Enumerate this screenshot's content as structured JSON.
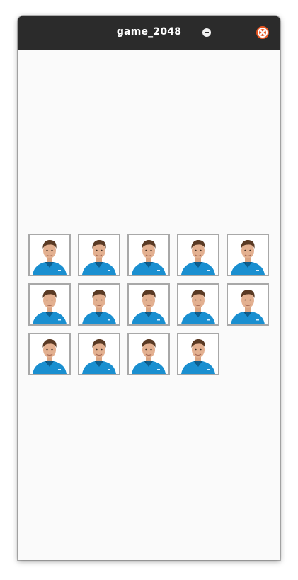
{
  "window": {
    "title": "game_2048"
  },
  "titlebar_buttons": {
    "minimize_icon": "minimize-icon",
    "close_icon": "close-icon"
  },
  "colors": {
    "titlebar_bg": "#2b2b2b",
    "close_button": "#e95420",
    "content_bg": "#fafafa",
    "tile_border": "#a8a8a8",
    "shirt_blue": "#1a8fd0"
  },
  "board": {
    "tile_image": "person-portrait-photo",
    "tile_count": 14,
    "rows": [
      {
        "tiles": 5
      },
      {
        "tiles": 5
      },
      {
        "tiles": 4
      }
    ]
  }
}
